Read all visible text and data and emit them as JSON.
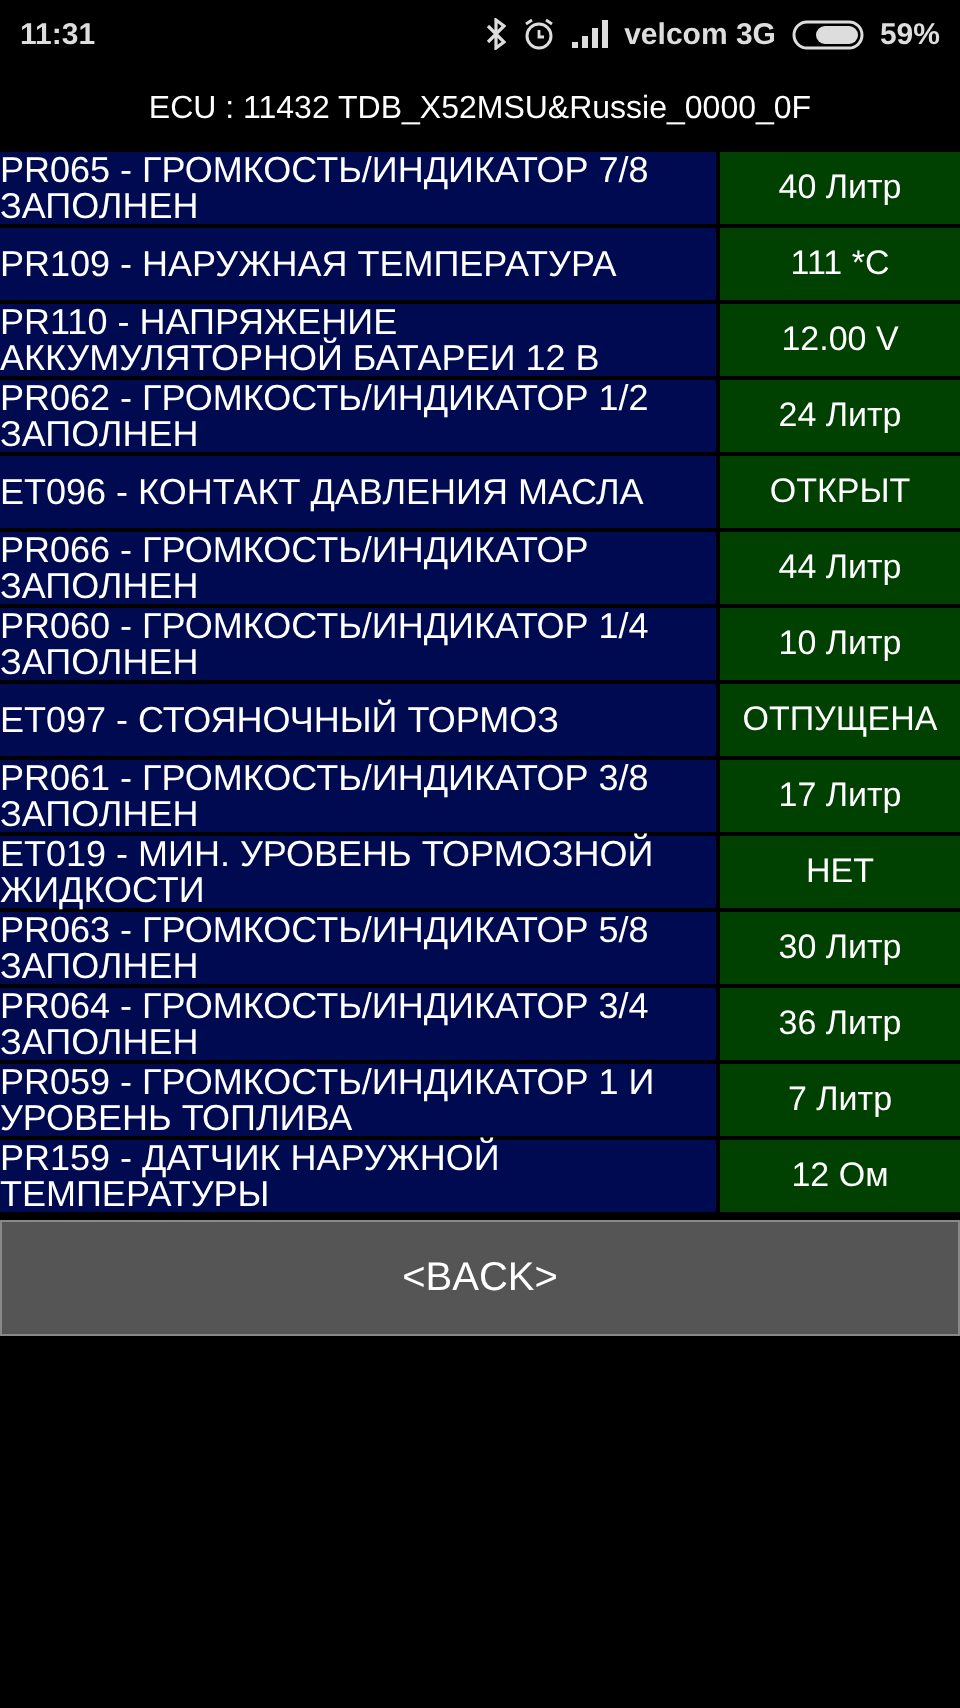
{
  "status_bar": {
    "time": "11:31",
    "carrier": "velcom 3G",
    "battery": "59%"
  },
  "header": {
    "title": "ECU : 11432  TDB_X52MSU&Russie_0000_0F"
  },
  "rows": [
    {
      "label": "PR065 - ГРОМКОСТЬ/ИНДИКАТОР 7/8 ЗАПОЛНЕН",
      "value": "40 Литр"
    },
    {
      "label": "PR109 - НАРУЖНАЯ ТЕМПЕРАТУРА",
      "value": "111 *C"
    },
    {
      "label": "PR110 - НАПРЯЖЕНИЕ АККУМУЛЯТОРНОЙ БАТАРЕИ 12 В",
      "value": "12.00 V"
    },
    {
      "label": "PR062 - ГРОМКОСТЬ/ИНДИКАТОР 1/2 ЗАПОЛНЕН",
      "value": "24 Литр"
    },
    {
      "label": "ET096 - КОНТАКТ ДАВЛЕНИЯ МАСЛА",
      "value": "ОТКРЫТ"
    },
    {
      "label": "PR066 - ГРОМКОСТЬ/ИНДИКАТОР ЗАПОЛНЕН",
      "value": "44 Литр"
    },
    {
      "label": "PR060 - ГРОМКОСТЬ/ИНДИКАТОР 1/4 ЗАПОЛНЕН",
      "value": "10 Литр"
    },
    {
      "label": "ET097 - СТОЯНОЧНЫЙ ТОРМОЗ",
      "value": "ОТПУЩЕНА"
    },
    {
      "label": "PR061 - ГРОМКОСТЬ/ИНДИКАТОР 3/8 ЗАПОЛНЕН",
      "value": "17 Литр"
    },
    {
      "label": "ET019 - МИН. УРОВЕНЬ ТОРМОЗНОЙ ЖИДКОСТИ",
      "value": "НЕТ"
    },
    {
      "label": "PR063 - ГРОМКОСТЬ/ИНДИКАТОР 5/8 ЗАПОЛНЕН",
      "value": "30 Литр"
    },
    {
      "label": "PR064 - ГРОМКОСТЬ/ИНДИКАТОР 3/4 ЗАПОЛНЕН",
      "value": "36 Литр"
    },
    {
      "label": "PR059 - ГРОМКОСТЬ/ИНДИКАТОР 1 И УРОВЕНЬ ТОПЛИВА",
      "value": "7 Литр"
    },
    {
      "label": "PR159 - ДАТЧИК НАРУЖНОЙ ТЕМПЕРАТУРЫ",
      "value": "12 Ом"
    }
  ],
  "back_button": {
    "label": "<BACK>"
  }
}
